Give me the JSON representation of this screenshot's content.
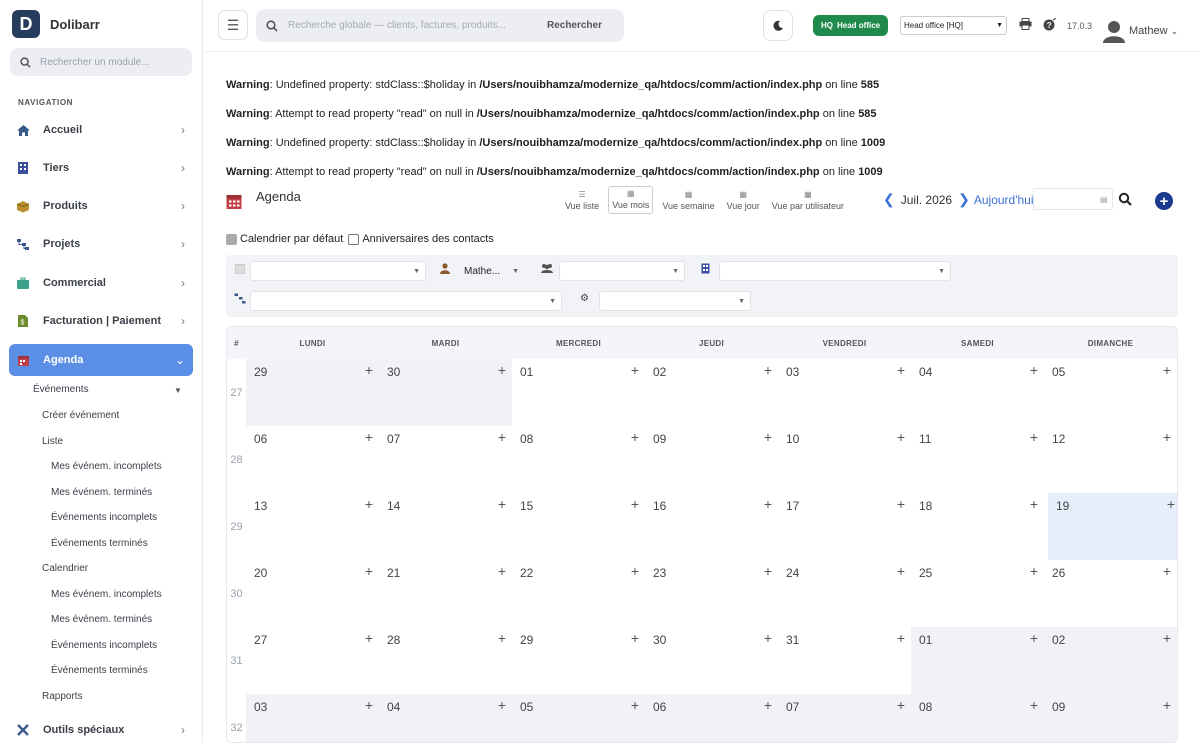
{
  "app": {
    "name": "Dolibarr",
    "logo_letter": "D"
  },
  "sidebar": {
    "search_placeholder": "Rechercher un module...",
    "nav_title": "NAVIGATION",
    "items": [
      {
        "label": "Accueil",
        "icon": "home-icon"
      },
      {
        "label": "Tiers",
        "icon": "building-icon"
      },
      {
        "label": "Produits",
        "icon": "box-icon"
      },
      {
        "label": "Projets",
        "icon": "project-icon"
      },
      {
        "label": "Commercial",
        "icon": "briefcase-icon"
      },
      {
        "label": "Facturation | Paiement",
        "icon": "invoice-icon"
      },
      {
        "label": "Agenda",
        "icon": "calendar-icon"
      },
      {
        "label": "Outils spéciaux",
        "icon": "tools-icon"
      }
    ],
    "sub": {
      "evenements": "Événements",
      "creer": "Créer événement",
      "liste": "Liste",
      "liste_items": [
        "Mes événem. incomplets",
        "Mes événem. terminés",
        "Événements incomplets",
        "Événements terminés"
      ],
      "calendrier": "Calendrier",
      "cal_items": [
        "Mes événem. incomplets",
        "Mes événem. terminés",
        "Événements incomplets",
        "Événements terminés"
      ],
      "rapports": "Rapports"
    }
  },
  "topbar": {
    "search_placeholder": "Recherche globale — clients, factures, produits...",
    "search_button": "Rechercher",
    "hq_code": "HQ",
    "hq_label": "Head office",
    "entity_select": "Head office [HQ]",
    "version": "17.0.3",
    "user": "Mathew"
  },
  "warnings": [
    {
      "label": "Warning",
      "msg": ": Undefined property: stdClass::$holiday in ",
      "path": "/Users/nouibhamza/modernize_qa/htdocs/comm/action/index.php",
      "on": " on line ",
      "line": "585"
    },
    {
      "label": "Warning",
      "msg": ": Attempt to read property \"read\" on null in ",
      "path": "/Users/nouibhamza/modernize_qa/htdocs/comm/action/index.php",
      "on": " on line ",
      "line": "585"
    },
    {
      "label": "Warning",
      "msg": ": Undefined property: stdClass::$holiday in ",
      "path": "/Users/nouibhamza/modernize_qa/htdocs/comm/action/index.php",
      "on": " on line ",
      "line": "1009"
    },
    {
      "label": "Warning",
      "msg": ": Attempt to read property \"read\" on null in ",
      "path": "/Users/nouibhamza/modernize_qa/htdocs/comm/action/index.php",
      "on": " on line ",
      "line": "1009"
    }
  ],
  "agenda": {
    "title": "Agenda",
    "views": [
      "Vue liste",
      "Vue mois",
      "Vue semaine",
      "Vue jour",
      "Vue par utilisateur"
    ],
    "active_view": "Vue mois",
    "month": "Juil. 2026",
    "today": "Aujourd'hui",
    "check_default": "Calendrier par défaut",
    "check_birthdays": "Anniversaires des contacts",
    "filter_user": "Mathe..."
  },
  "calendar": {
    "headers": [
      "#",
      "LUNDI",
      "MARDI",
      "MERCREDI",
      "JEUDI",
      "VENDREDI",
      "SAMEDI",
      "DIMANCHE"
    ],
    "weeks": [
      {
        "num": "27",
        "days": [
          "29",
          "30",
          "01",
          "02",
          "03",
          "04",
          "05"
        ]
      },
      {
        "num": "28",
        "days": [
          "06",
          "07",
          "08",
          "09",
          "10",
          "11",
          "12"
        ]
      },
      {
        "num": "29",
        "days": [
          "13",
          "14",
          "15",
          "16",
          "17",
          "18",
          "19"
        ]
      },
      {
        "num": "30",
        "days": [
          "20",
          "21",
          "22",
          "23",
          "24",
          "25",
          "26"
        ]
      },
      {
        "num": "31",
        "days": [
          "27",
          "28",
          "29",
          "30",
          "31",
          "01",
          "02"
        ]
      },
      {
        "num": "32",
        "days": [
          "03",
          "04",
          "05",
          "06",
          "07",
          "08",
          "09"
        ]
      }
    ],
    "add_symbol": "+"
  }
}
